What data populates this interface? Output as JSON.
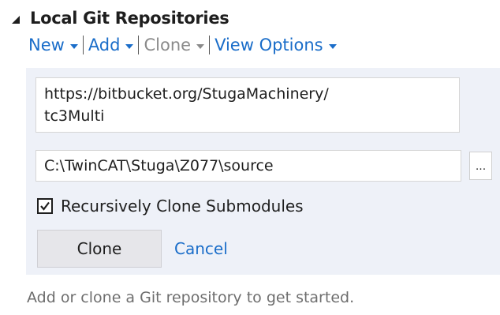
{
  "section": {
    "title": "Local Git Repositories",
    "collapse_icon": "collapse-triangle-icon"
  },
  "toolbar": {
    "new_label": "New",
    "add_label": "Add",
    "clone_label": "Clone",
    "view_options_label": "View Options"
  },
  "clone_panel": {
    "url_value": "https://bitbucket.org/StugaMachinery/\ntc3Multi",
    "path_value": "C:\\TwinCAT\\Stuga\\Z077\\source",
    "browse_label": "...",
    "recursive_label": "Recursively Clone Submodules",
    "recursive_checked": true,
    "clone_button_label": "Clone",
    "cancel_label": "Cancel"
  },
  "hint": "Add or clone a Git repository to get started.",
  "colors": {
    "link": "#1a6dc9",
    "disabled": "#8a8a8a",
    "panel_bg": "#eef1f8"
  }
}
